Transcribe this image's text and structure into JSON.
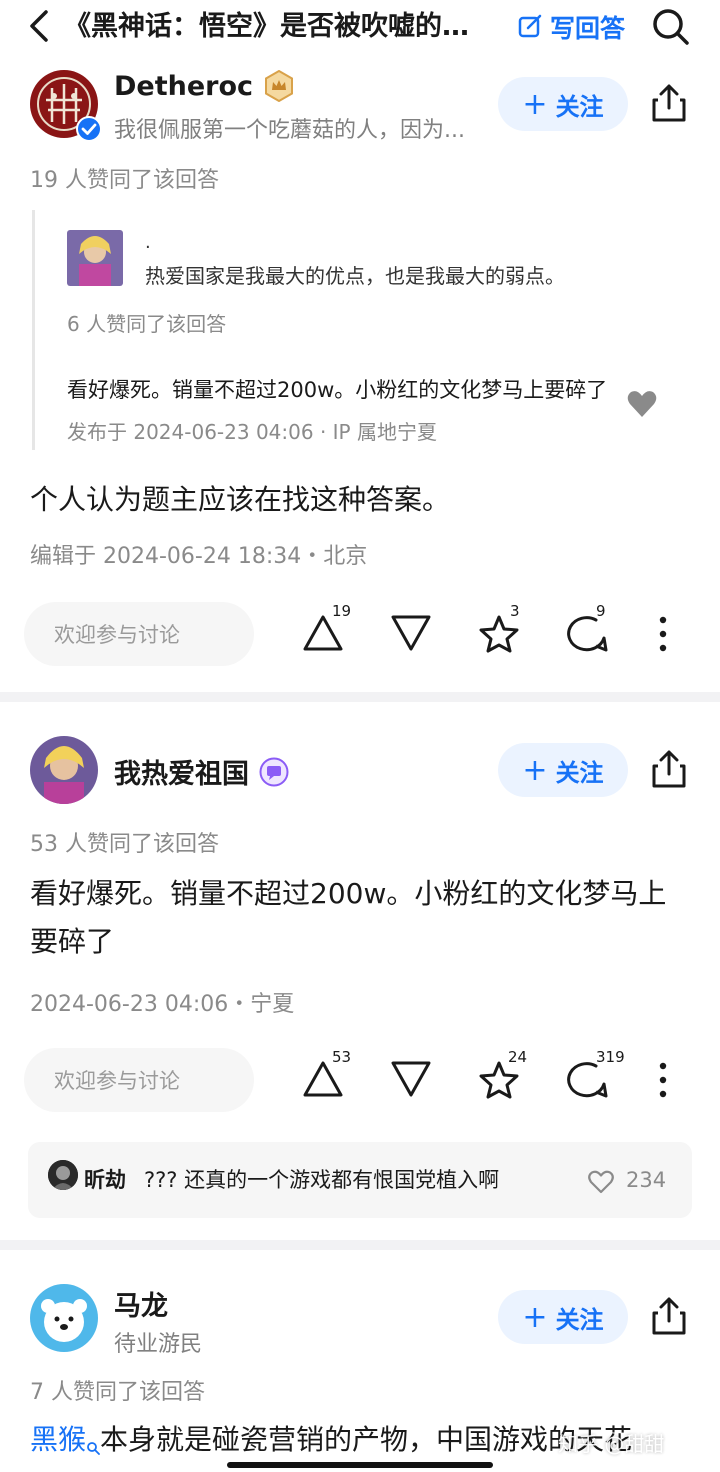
{
  "header": {
    "question_title": "《黑神话：悟空》是否被吹嘘的太...",
    "write_answer_label": "写回答"
  },
  "answers": [
    {
      "author": "Detheroc",
      "bio": "我很佩服第一个吃蘑菇的人，因为...",
      "follow_label": "关注",
      "votes_text": "19 人赞同了该回答",
      "quoted": {
        "author": ".",
        "bio": "热爱国家是我最大的优点，也是我最大的弱点。",
        "votes_text": "6 人赞同了该回答",
        "text": "看好爆死。销量不超过200w。小粉红的文化梦马上要碎了",
        "meta": "发布于 2024-06-23 04:06 · IP 属地宁夏"
      },
      "body": "个人认为题主应该在找这种答案。",
      "meta": "编辑于 2024-06-24 18:34・北京",
      "comment_placeholder": "欢迎参与讨论",
      "upvotes": "19",
      "favorites": "3",
      "comments": "9"
    },
    {
      "author": "我热爱祖国",
      "follow_label": "关注",
      "votes_text": "53 人赞同了该回答",
      "body": "看好爆死。销量不超过200w。小粉红的文化梦马上要碎了",
      "meta": "2024-06-23 04:06・宁夏",
      "comment_placeholder": "欢迎参与讨论",
      "upvotes": "53",
      "favorites": "24",
      "comments": "319",
      "hot_comment": {
        "user": "昕劫",
        "text": "??? 还真的一个游戏都有恨国党植入啊",
        "likes": "234"
      }
    },
    {
      "author": "马龙",
      "bio": "待业游民",
      "follow_label": "关注",
      "votes_text": "7 人赞同了该回答",
      "body_link": "黑猴",
      "body_rest": "本身就是碰瓷营销的产物，中国游戏的天花"
    }
  ],
  "watermark": "知乎 @甜甜",
  "colors": {
    "accent": "#1772f6",
    "follow_bg": "#ebf3ff",
    "muted": "#8a8a8a"
  }
}
